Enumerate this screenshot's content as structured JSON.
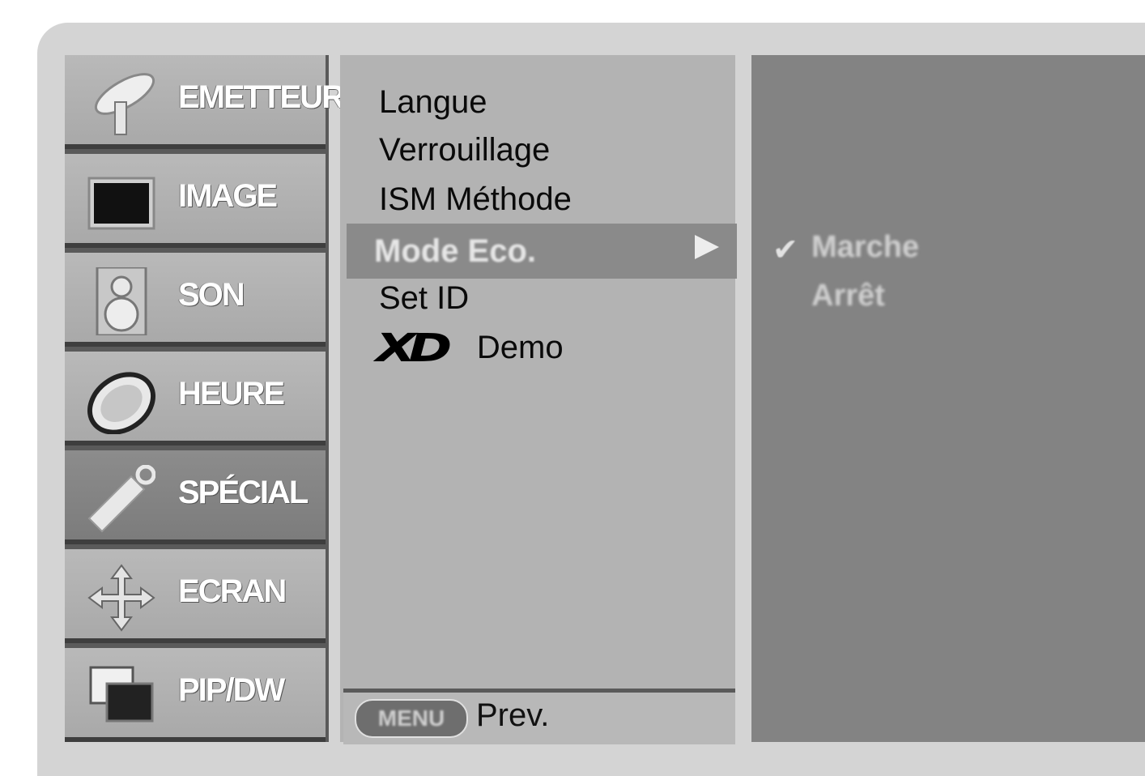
{
  "sidebar": {
    "items": [
      {
        "label": "EMETTEUR",
        "icon": "satellite-dish-icon"
      },
      {
        "label": "IMAGE",
        "icon": "tv-screen-icon"
      },
      {
        "label": "SON",
        "icon": "speaker-icon"
      },
      {
        "label": "HEURE",
        "icon": "clock-icon"
      },
      {
        "label": "SPÉCIAL",
        "icon": "tag-icon",
        "selected": true
      },
      {
        "label": "ECRAN",
        "icon": "move-arrows-icon"
      },
      {
        "label": "PIP/DW",
        "icon": "pip-windows-icon"
      }
    ]
  },
  "submenu": {
    "items": [
      {
        "label": "Langue"
      },
      {
        "label": "Verrouillage"
      },
      {
        "label": "ISM Méthode"
      },
      {
        "label": "Mode Eco.",
        "selected": true
      },
      {
        "label": "Set ID"
      },
      {
        "logo": "XD",
        "label": "Demo"
      }
    ]
  },
  "options": {
    "checked": "✔",
    "items": [
      "Marche",
      "Arrêt"
    ]
  },
  "footer": {
    "menu_key": "MENU",
    "prev_label": "Prev."
  }
}
